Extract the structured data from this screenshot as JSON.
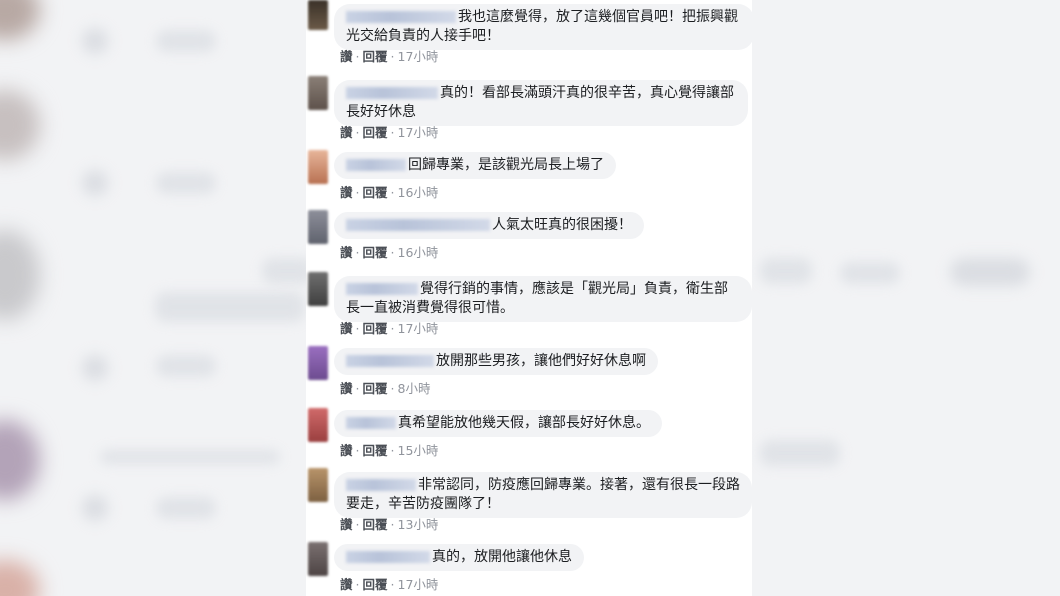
{
  "comments": [
    {
      "text": "我也這麼覺得，放了這幾個官員吧！把振興觀光交給負責的人接手吧！",
      "like": "讚",
      "reply": "回覆",
      "time": "17小時"
    },
    {
      "text": "真的！看部長滿頭汗真的很辛苦，真心覺得讓部長好好休息",
      "like": "讚",
      "reply": "回覆",
      "time": "17小時"
    },
    {
      "text": "回歸專業，是該觀光局長上場了",
      "like": "讚",
      "reply": "回覆",
      "time": "16小時"
    },
    {
      "text": "人氣太旺真的很困擾！",
      "like": "讚",
      "reply": "回覆",
      "time": "16小時"
    },
    {
      "text": "覺得行銷的事情，應該是「觀光局」負責，衛生部長一直被消費覺得很可惜。",
      "like": "讚",
      "reply": "回覆",
      "time": "17小時"
    },
    {
      "text": "放開那些男孩，讓他們好好休息啊",
      "like": "讚",
      "reply": "回覆",
      "time": "8小時"
    },
    {
      "text": "真希望能放他幾天假，讓部長好好休息。",
      "like": "讚",
      "reply": "回覆",
      "time": "15小時"
    },
    {
      "text": "非常認同，防疫應回歸專業。接著，還有很長一段路要走，辛苦防疫團隊了！",
      "like": "讚",
      "reply": "回覆",
      "time": "13小時"
    },
    {
      "text": "真的，放開他讓他休息",
      "like": "讚",
      "reply": "回覆",
      "time": "17小時"
    }
  ],
  "colors": {
    "bubble": "#f2f3f5",
    "text": "#1c1e21",
    "meta": "#90949c",
    "action": "#4b4f56"
  }
}
